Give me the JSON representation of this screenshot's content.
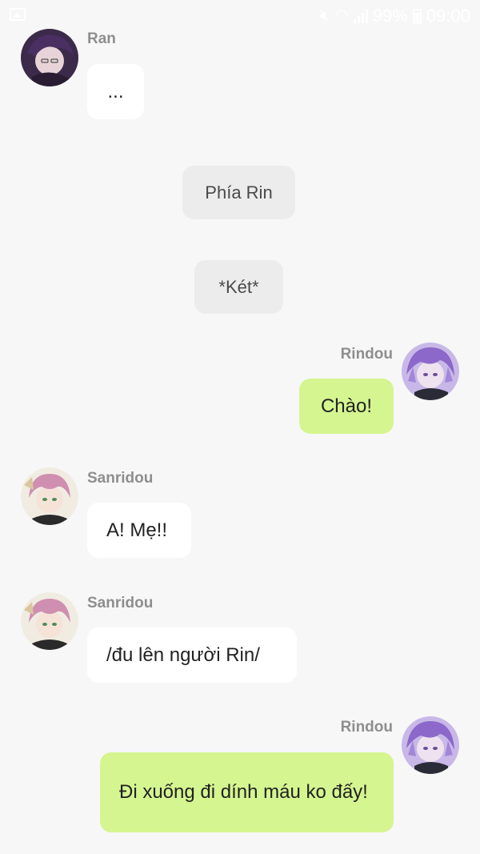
{
  "status_bar": {
    "battery": "99%",
    "time": "09:00",
    "icons": [
      "image-icon",
      "mute-icon",
      "wifi-icon",
      "signal-icon",
      "battery-icon"
    ]
  },
  "messages": [
    {
      "type": "incoming",
      "sender": "Ran",
      "text": "...",
      "avatar": "ran-avatar"
    },
    {
      "type": "system",
      "text": "Phía Rin"
    },
    {
      "type": "system",
      "text": "*Két*"
    },
    {
      "type": "outgoing",
      "sender": "Rindou",
      "text": "Chào!",
      "avatar": "rindou-avatar"
    },
    {
      "type": "incoming",
      "sender": "Sanridou",
      "text": "A! Mẹ!!",
      "avatar": "sanridou-avatar"
    },
    {
      "type": "incoming",
      "sender": "Sanridou",
      "text": "/đu lên người Rin/",
      "avatar": "sanridou-avatar"
    },
    {
      "type": "outgoing",
      "sender": "Rindou",
      "text": "Đi xuống đi dính máu ko đấy!",
      "avatar": "rindou-avatar"
    }
  ],
  "colors": {
    "background": "#f7f7f7",
    "outgoing_bubble": "#d5f590",
    "incoming_bubble": "#ffffff",
    "system_bubble": "#ececec",
    "name_text": "#8e8e8e"
  }
}
